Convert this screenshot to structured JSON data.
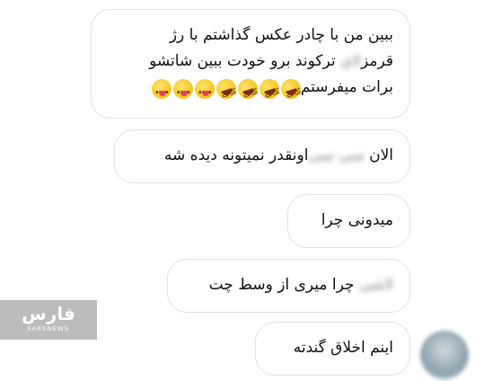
{
  "messages": [
    {
      "lines": [
        "ببین من با چادر عکس گذاشتم با رژ",
        "قرمز",
        "ترکوند برو خودت ببین شاتشو",
        "برات میفرستم"
      ],
      "blurred": "لای",
      "emojis": [
        "face-with-tongue",
        "face-with-tongue",
        "face-with-tongue",
        "rolling-laughing",
        "rolling-laughing",
        "rolling-laughing",
        "rolling-laughing"
      ]
    },
    {
      "prefix": "الان",
      "blurred": "سی سی",
      "text": "اونقدر نمیتونه دیده شه"
    },
    {
      "text": "میدونی چرا"
    },
    {
      "blurred": "لاشی",
      "text": "چرا میری از وسط  چت"
    },
    {
      "text": "اینم اخلاق گندته"
    }
  ],
  "watermark": {
    "title": "فارس",
    "subtitle": "FARSNEWS"
  },
  "colors": {
    "bubble_border": "#e3e3e3",
    "watermark_bg": "#b7b7b7"
  }
}
